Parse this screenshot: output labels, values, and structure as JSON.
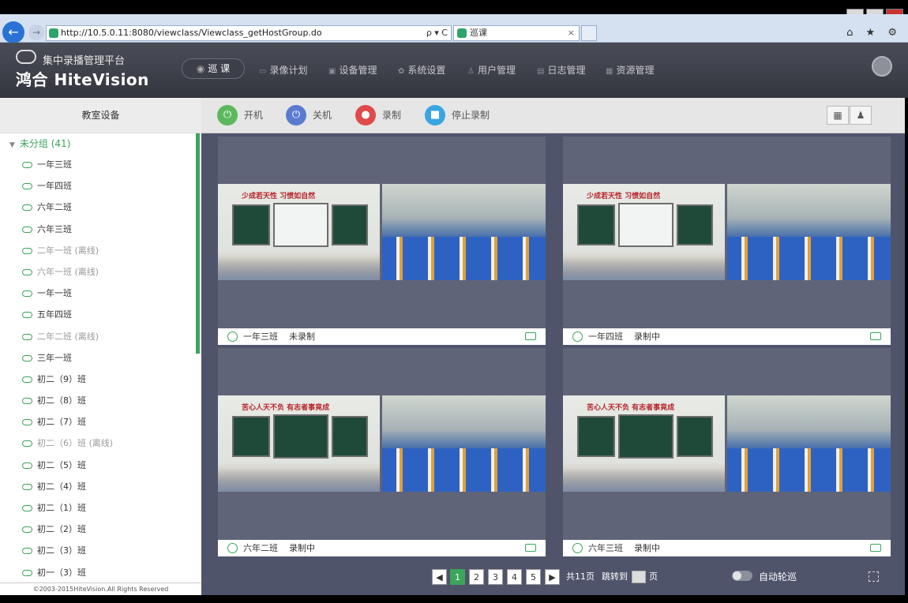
{
  "browser": {
    "url": "http://10.5.0.11:8080/viewclass/Viewclass_getHostGroup.do",
    "url_controls": "ρ ▾ C",
    "tab_title": "巡课",
    "tab_close": "×",
    "back_icon": "←",
    "forward_icon": "→",
    "right_icons": "⌂ ★ ⚙"
  },
  "header": {
    "logo_subtitle": "集中录播管理平台",
    "logo_main": "鸿合 HiteVision",
    "nav_active": "巡 课",
    "nav": [
      {
        "label": "录像计划",
        "icon": "▭"
      },
      {
        "label": "设备管理",
        "icon": "▣"
      },
      {
        "label": "系统设置",
        "icon": "✿"
      },
      {
        "label": "用户管理",
        "icon": "♙"
      },
      {
        "label": "日志管理",
        "icon": "▤"
      },
      {
        "label": "资源管理",
        "icon": "▦"
      }
    ]
  },
  "sidebar": {
    "title": "教室设备",
    "group": "未分组 (41)",
    "copyright": "©2003-2015HiteVision.All Rights Reserved",
    "items": [
      {
        "label": "一年三班",
        "offline": false
      },
      {
        "label": "一年四班",
        "offline": false
      },
      {
        "label": "六年二班",
        "offline": false
      },
      {
        "label": "六年三班",
        "offline": false
      },
      {
        "label": "二年一班 (离线)",
        "offline": true
      },
      {
        "label": "六年一班 (离线)",
        "offline": true
      },
      {
        "label": "一年一班",
        "offline": false
      },
      {
        "label": "五年四班",
        "offline": false
      },
      {
        "label": "二年二班 (离线)",
        "offline": true
      },
      {
        "label": "三年一班",
        "offline": false
      },
      {
        "label": "初二（9）班",
        "offline": false
      },
      {
        "label": "初二（8）班",
        "offline": false
      },
      {
        "label": "初二（7）班",
        "offline": false
      },
      {
        "label": "初二（6）班 (离线)",
        "offline": true
      },
      {
        "label": "初二（5）班",
        "offline": false
      },
      {
        "label": "初二（4）班",
        "offline": false
      },
      {
        "label": "初二（1）班",
        "offline": false
      },
      {
        "label": "初二（2）班",
        "offline": false
      },
      {
        "label": "初二（3）班",
        "offline": false
      },
      {
        "label": "初一（3）班",
        "offline": false
      }
    ]
  },
  "toolbar": {
    "power_on": "开机",
    "power_off": "关机",
    "record": "录制",
    "stop_record": "停止录制",
    "colors": {
      "on": "#5cb85c",
      "off": "#5b7bd0",
      "record": "#e04a4a",
      "stop": "#3aa6e0"
    }
  },
  "tiles": [
    {
      "name": "一年三班",
      "status": "未录制",
      "banner": "少成若天性 习惯如自然"
    },
    {
      "name": "一年四班",
      "status": "录制中",
      "banner": "少成若天性 习惯如自然"
    },
    {
      "name": "六年二班",
      "status": "录制中",
      "banner": "苦心人天不负 有志者事竟成"
    },
    {
      "name": "六年三班",
      "status": "录制中",
      "banner": "苦心人天不负 有志者事竟成"
    }
  ],
  "pager": {
    "prev": "◀",
    "next": "▶",
    "pages": [
      "1",
      "2",
      "3",
      "4",
      "5"
    ],
    "current": "1",
    "total": "共11页",
    "jump_label": "跳转到",
    "page_unit": "页"
  },
  "auto_patrol": "自动轮巡",
  "colors": {
    "accent": "#3aa55b",
    "header": "#3a3c46",
    "main_bg": "#50546b"
  }
}
